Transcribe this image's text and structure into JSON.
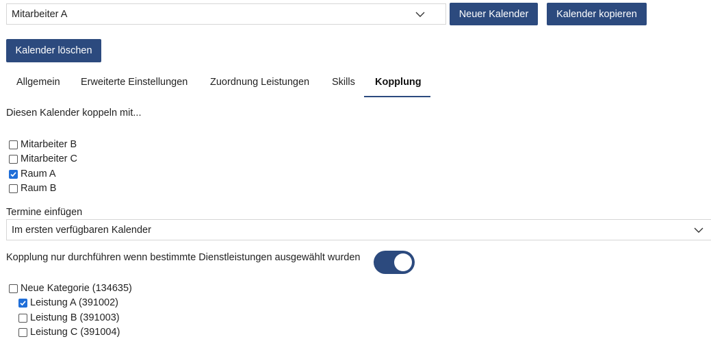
{
  "calendar_select": {
    "value": "Mitarbeiter A"
  },
  "buttons": {
    "new_calendar": "Neuer Kalender",
    "copy_calendar": "Kalender kopieren",
    "delete_calendar": "Kalender löschen"
  },
  "tabs": [
    {
      "label": "Allgemein",
      "active": false
    },
    {
      "label": "Erweiterte Einstellungen",
      "active": false
    },
    {
      "label": "Zuordnung Leistungen",
      "active": false
    },
    {
      "label": "Skills",
      "active": false
    },
    {
      "label": "Kopplung",
      "active": true
    }
  ],
  "coupling": {
    "heading": "Diesen Kalender koppeln mit...",
    "calendars": [
      {
        "label": "Mitarbeiter B",
        "checked": false
      },
      {
        "label": "Mitarbeiter C",
        "checked": false
      },
      {
        "label": "Raum A",
        "checked": true
      },
      {
        "label": "Raum B",
        "checked": false
      }
    ],
    "insert_label": "Termine einfügen",
    "insert_select_value": "Im ersten verfügbaren Kalender",
    "condition_label": "Kopplung nur durchführen wenn bestimmte Dienstleistungen ausgewählt wurden",
    "condition_enabled": true,
    "category": {
      "label": "Neue Kategorie (134635)",
      "checked": false
    },
    "services": [
      {
        "label": "Leistung A (391002)",
        "checked": true
      },
      {
        "label": "Leistung B (391003)",
        "checked": false
      },
      {
        "label": "Leistung C (391004)",
        "checked": false
      }
    ]
  },
  "colors": {
    "primary": "#2c4a7e",
    "checkbox_checked": "#1f6ed8"
  },
  "icons": {
    "dropdown": "chevron-down-icon",
    "check": "checkmark-icon"
  }
}
